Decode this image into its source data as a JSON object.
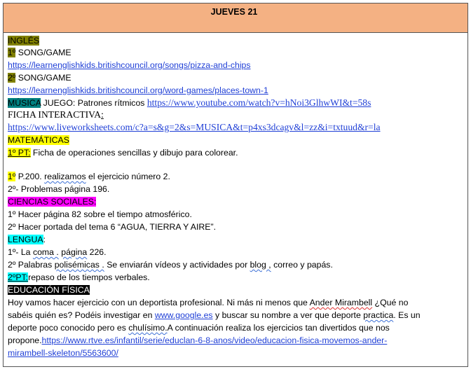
{
  "header": {
    "title": "JUEVES  21"
  },
  "ingles": {
    "heading": "INGLÉS",
    "item1_num": "1º",
    "item1_text": " SONG/GAME",
    "item1_link": "https://learnenglishkids.britishcouncil.org/songs/pizza-and-chips",
    "item2_num": "2º",
    "item2_text": " SONG/GAME",
    "item2_link": "https://learnenglishkids.britishcouncil.org/word-games/places-town-1"
  },
  "musica": {
    "heading": "MÚSICA",
    "juego_text": " JUEGO: Patrones rítmicos ",
    "juego_link": "https://www.youtube.com/watch?v=hNoi3GlhwWI&t=58s",
    "ficha_text": "FICHA INTERACTIVA",
    "ficha_colon": ":",
    "ficha_link": "https://www.liveworksheets.com/c?a=s&g=2&s=MUSICA&t=p4xs3dcagv&l=zz&i=txtuud&r=la"
  },
  "matematicas": {
    "heading": "MATEMÁTICAS",
    "pt_label": "1º PT:",
    "pt_text": " Ficha de operaciones sencillas y dibujo para colorear.",
    "line1_num": "1º",
    "line1_a": " P.200. ",
    "line1_b": "realizamos",
    "line1_c": " el ejercicio número 2.",
    "line2": "2º- Problemas página 196."
  },
  "sociales": {
    "heading": "CIENCIAS SOCIALES:",
    "line1": " 1º Hacer página 82 sobre el tiempo atmosférico.",
    "line2": "2º Hacer portada del tema 6 “AGUA, TIERRA Y AIRE”."
  },
  "lengua": {
    "heading": "LENGUA",
    "colon": ":",
    "line1_a": "1º- La ",
    "line1_b": "coma .",
    "line1_c": " ",
    "line1_d": "página",
    "line1_e": " 226.",
    "line2_a": "2º Palabras ",
    "line2_b": "polisémicas .",
    "line2_c": " Se enviarán vídeos y actividades por ",
    "line2_d": "blog ,",
    "line2_e": " correo y papás.",
    "pt_label": "2ºPT:",
    "pt_text": "repaso de los tiempos verbales."
  },
  "ef": {
    "heading": "EDUCACIÓN FÍSICA",
    "p1_a": "Hoy  vamos hacer ejercicio con un deportista profesional. Ni más ni menos que ",
    "p1_b": "Ander Mirambell",
    "p1_c": " ¿Qué no",
    "p2_a": "sabéis quién es? Podéis investigar en ",
    "p2_link": "www.google.es",
    "p2_b": " y buscar su nombre a ver que deporte ",
    "p2_c": "practica",
    "p2_d": ".  Es un",
    "p3_a": "deporte poco conocido pero es ",
    "p3_b": "chulísimo.",
    "p3_c": "A continuación realiza los ejercicios tan divertidos que nos",
    "p4_a": "propone.",
    "p4_link": "https://www.rtve.es/infantil/serie/educlan-6-8-anos/video/educacion-fisica-movemos-ander-",
    "p5_link": "mirambell-skeleton/5563600/"
  }
}
